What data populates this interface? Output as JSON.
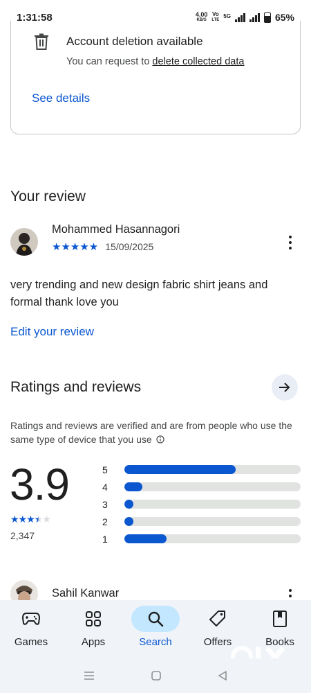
{
  "status": {
    "time": "1:31:58",
    "net_speed": "4.00",
    "net_unit": "KB/S",
    "volte": "Vo LTE",
    "volte_top": "Vo",
    "volte_bottom": "LTE",
    "network_type": "5G",
    "battery": "65%"
  },
  "data_safety": {
    "icon": "trash-icon",
    "title": "Account deletion available",
    "subtitle_prefix": "You can request to ",
    "subtitle_link": "delete collected data",
    "see_details": "See details"
  },
  "your_review": {
    "heading": "Your review",
    "reviewer": "Mohammed Hasannagori",
    "stars": "★★★★★",
    "rating": 5,
    "date": "15/09/2025",
    "text": "very trending and new design fabric shirt jeans and formal thank love you",
    "edit_label": "Edit your review"
  },
  "ratings": {
    "heading": "Ratings and reviews",
    "note": "Ratings and reviews are verified and are from people who use the same type of device that you use",
    "score": "3.9",
    "count": "2,347",
    "distribution": [
      {
        "label": "5",
        "fraction": 0.63
      },
      {
        "label": "4",
        "fraction": 0.1
      },
      {
        "label": "3",
        "fraction": 0.05
      },
      {
        "label": "2",
        "fraction": 0.05
      },
      {
        "label": "1",
        "fraction": 0.24
      }
    ]
  },
  "next_review": {
    "reviewer": "Sahil Kanwar"
  },
  "bottom_nav": {
    "items": [
      {
        "label": "Games",
        "icon": "gamepad-icon",
        "active": false
      },
      {
        "label": "Apps",
        "icon": "apps-grid-icon",
        "active": false
      },
      {
        "label": "Search",
        "icon": "search-icon",
        "active": true
      },
      {
        "label": "Offers",
        "icon": "tag-icon",
        "active": false
      },
      {
        "label": "Books",
        "icon": "book-icon",
        "active": false
      }
    ]
  },
  "watermark": "OLX",
  "colors": {
    "accent": "#0b57d0",
    "nav_bg": "#f0f4f9",
    "active_pill": "#c2e7ff"
  }
}
